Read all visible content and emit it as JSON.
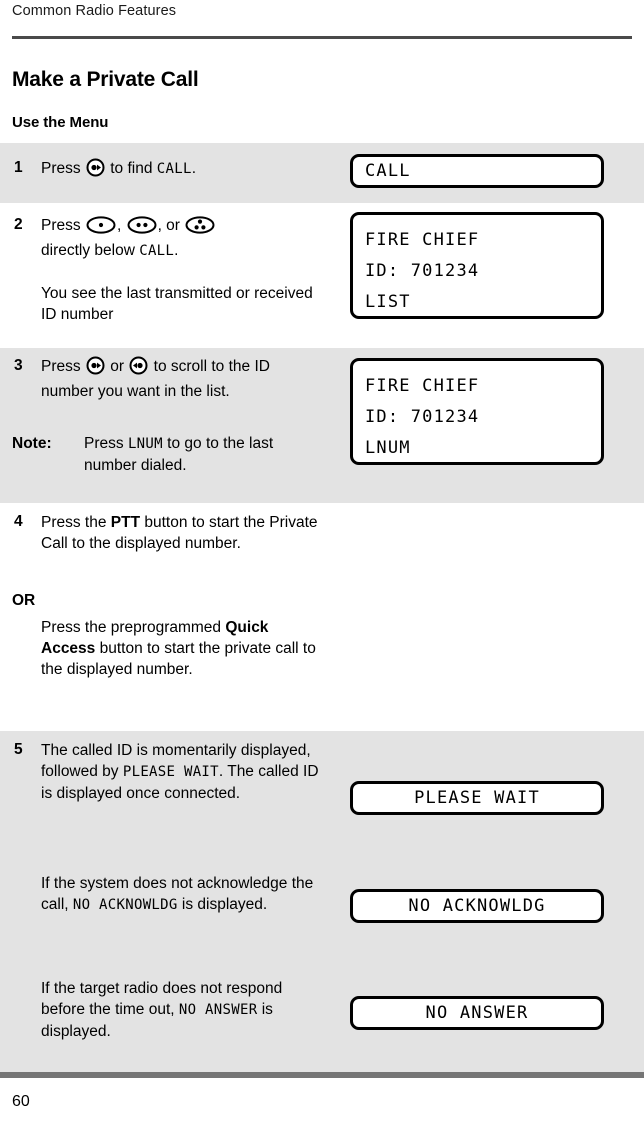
{
  "running_head": "Common Radio Features",
  "page_number": "60",
  "headings": {
    "title": "Make a Private Call",
    "subtitle": "Use the Menu"
  },
  "labels": {
    "or": "OR",
    "note": "Note:"
  },
  "steps": [
    {
      "number": "1",
      "text_before_icon": "Press ",
      "icon": "menu-select-dot-right-icon",
      "text_after_icon": " to find ",
      "mono_term": "CALL",
      "text_end": "."
    },
    {
      "number": "2",
      "line1_a": "Press ",
      "icon1": "softkey-one-dot-icon",
      "line1_b": ", ",
      "icon2": "softkey-two-dots-icon",
      "line1_c": ", or ",
      "icon3": "softkey-three-dots-icon",
      "line2_a": "directly below ",
      "line2_mono": "CALL",
      "line2_b": ".",
      "para2": "You see the last transmitted or received ID number"
    },
    {
      "number": "3",
      "line_a": "Press ",
      "icon1": "scroll-right-icon",
      "line_b": " or ",
      "icon2": "scroll-left-icon",
      "line_c": " to scroll to the ID number you want in the list.",
      "note_a": "Press ",
      "note_mono": "LNUM",
      "note_b": " to go to the last number dialed."
    },
    {
      "number": "4",
      "para1_a": "Press the ",
      "para1_bold": "PTT",
      "para1_b": " button to start the Private Call to the displayed number.",
      "or_para_a": "Press the preprogrammed ",
      "or_para_bold": "Quick Access",
      "or_para_b": " button to start the private call to the displayed number."
    },
    {
      "number": "5",
      "para1_a": "The called ID is momentarily displayed, followed by ",
      "para1_mono": "PLEASE WAIT",
      "para1_b": ". The called ID is displayed once connected.",
      "para2_a": "If the system does not acknowledge the call, ",
      "para2_mono": "NO ACKNOWLDG",
      "para2_b": " is displayed.",
      "para3_a": "If the target radio does not respond before the time out, ",
      "para3_mono": "NO ANSWER",
      "para3_b": " is displayed."
    }
  ],
  "displays": {
    "step1": {
      "line1": "CALL"
    },
    "step2": {
      "line1": "FIRE CHIEF",
      "line2": "ID: 701234",
      "line3": "LIST"
    },
    "step3": {
      "line1": "FIRE CHIEF",
      "line2": "ID: 701234",
      "line3": "LNUM"
    },
    "step5_a": {
      "line1": "PLEASE WAIT"
    },
    "step5_b": {
      "line1": "NO ACKNOWLDG"
    },
    "step5_c": {
      "line1": "NO ANSWER"
    }
  },
  "colors": {
    "shaded_row": "#e3e3e3",
    "rule": "#4a4a4a",
    "footer_rule": "#757575",
    "text": "#000000"
  }
}
